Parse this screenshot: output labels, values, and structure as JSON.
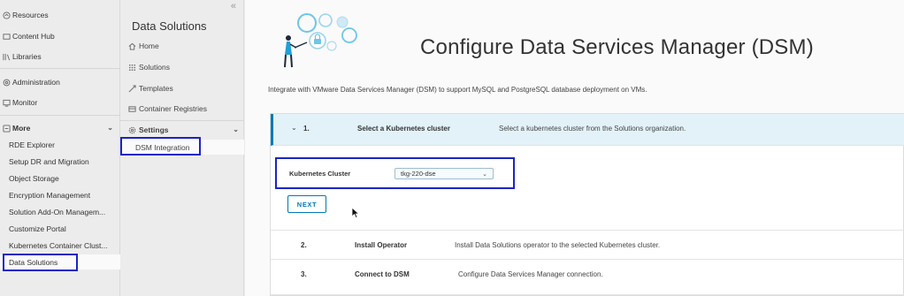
{
  "leftnav": {
    "items": [
      {
        "label": "Resources",
        "icon": "resources-icon"
      },
      {
        "label": "Content Hub",
        "icon": "content-hub-icon"
      },
      {
        "label": "Libraries",
        "icon": "libraries-icon"
      },
      {
        "label": "Administration",
        "icon": "administration-icon"
      },
      {
        "label": "Monitor",
        "icon": "monitor-icon"
      }
    ],
    "more_label": "More",
    "more_items": [
      "RDE Explorer",
      "Setup DR and Migration",
      "Object Storage",
      "Encryption Management",
      "Solution Add-On Managem...",
      "Customize Portal",
      "Kubernetes Container Clust...",
      "Data Solutions"
    ]
  },
  "subnav": {
    "title": "Data Solutions",
    "items": [
      {
        "label": "Home",
        "icon": "home-icon"
      },
      {
        "label": "Solutions",
        "icon": "solutions-icon"
      },
      {
        "label": "Templates",
        "icon": "templates-icon"
      },
      {
        "label": "Container Registries",
        "icon": "container-registries-icon"
      }
    ],
    "settings_label": "Settings",
    "settings_items": [
      "DSM Integration"
    ]
  },
  "main": {
    "title": "Configure Data Services Manager (DSM)",
    "intro": "Integrate with VMware Data Services Manager (DSM) to support MySQL and PostgreSQL database deployment on VMs.",
    "steps": [
      {
        "num": "1.",
        "name": "Select a Kubernetes cluster",
        "desc": "Select a kubernetes cluster from the Solutions organization."
      },
      {
        "num": "2.",
        "name": "Install Operator",
        "desc": "Install Data Solutions operator to the selected Kubernetes cluster."
      },
      {
        "num": "3.",
        "name": "Connect to DSM",
        "desc": "Configure Data Services Manager connection."
      }
    ],
    "cluster_label": "Kubernetes Cluster",
    "cluster_value": "tkg-220-dse",
    "next_label": "NEXT"
  },
  "colors": {
    "accent": "#0079b8",
    "highlight": "#1a24c8",
    "active_step_bg": "#e2f2f8"
  }
}
